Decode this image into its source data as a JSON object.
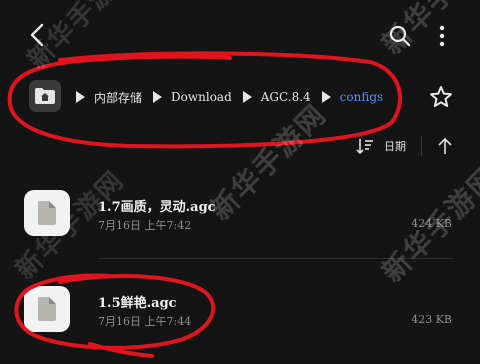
{
  "header": {
    "back_icon": "back-arrow-icon",
    "search_icon": "search-icon",
    "more_icon": "more-vertical-icon"
  },
  "breadcrumb": {
    "home_icon": "folder-home-icon",
    "items": [
      "内部存储",
      "Download",
      "AGC.8.4",
      "configs"
    ],
    "star_icon": "star-icon"
  },
  "sort": {
    "label": "日期",
    "icon": "sort-icon",
    "direction_icon": "arrow-up-icon"
  },
  "files": [
    {
      "name": "1.7画质，灵动.agc",
      "date": "7月16日 上午7:42",
      "size": "424 KB"
    },
    {
      "name": "1.5鲜艳.agc",
      "date": "7月16日 上午7:44",
      "size": "423 KB"
    }
  ],
  "watermark": {
    "text": "新华手游网"
  },
  "colors": {
    "background": "#141414",
    "accent": "#5d8ff7",
    "annotation": "#e0141e"
  }
}
